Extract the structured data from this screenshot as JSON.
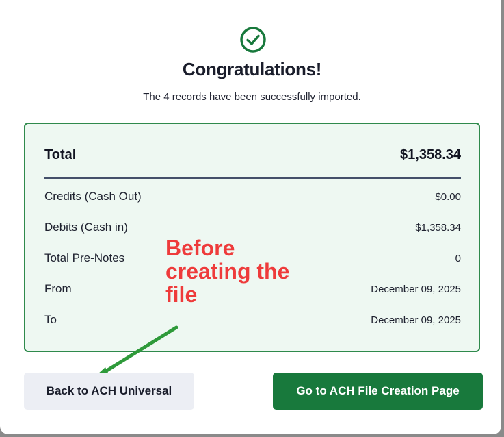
{
  "modal": {
    "title": "Congratulations!",
    "subtitle": "The 4 records have been successfully imported."
  },
  "summary": {
    "total": {
      "label": "Total",
      "value": "$1,358.34"
    },
    "rows": [
      {
        "label": "Credits (Cash Out)",
        "value": "$0.00"
      },
      {
        "label": "Debits (Cash in)",
        "value": "$1,358.34"
      },
      {
        "label": "Total Pre-Notes",
        "value": "0"
      },
      {
        "label": "From",
        "value": "December 09, 2025"
      },
      {
        "label": "To",
        "value": "December 09, 2025"
      }
    ]
  },
  "annotation": {
    "text": "Before\ncreating the\nfile",
    "color": "#ee3b3b",
    "arrow_color": "#2e9a3a"
  },
  "buttons": {
    "back_label": "Back to ACH Universal",
    "go_label": "Go to ACH File Creation Page"
  },
  "colors": {
    "success_green": "#18793c",
    "panel_bg": "#eef8f2",
    "panel_border": "#2f8a4c"
  },
  "icons": {
    "success": "check-circle-icon"
  }
}
